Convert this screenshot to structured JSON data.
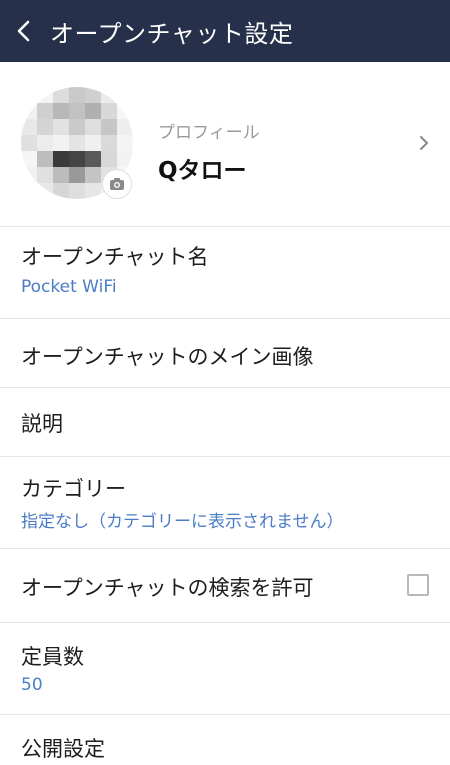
{
  "header": {
    "title": "オープンチャット設定"
  },
  "profile": {
    "label": "プロフィール",
    "name": "Qタロー"
  },
  "settings": {
    "name": {
      "title": "オープンチャット名",
      "value": "Pocket WiFi"
    },
    "main_image": {
      "title": "オープンチャットのメイン画像"
    },
    "description": {
      "title": "説明"
    },
    "category": {
      "title": "カテゴリー",
      "value": "指定なし（カテゴリーに表示されません）"
    },
    "search": {
      "title": "オープンチャットの検索を許可",
      "checked": false
    },
    "capacity": {
      "title": "定員数",
      "value": "50"
    },
    "visibility": {
      "title": "公開設定"
    }
  },
  "colors": {
    "header_bg": "#26304a",
    "link_blue": "#4a7cc7"
  }
}
